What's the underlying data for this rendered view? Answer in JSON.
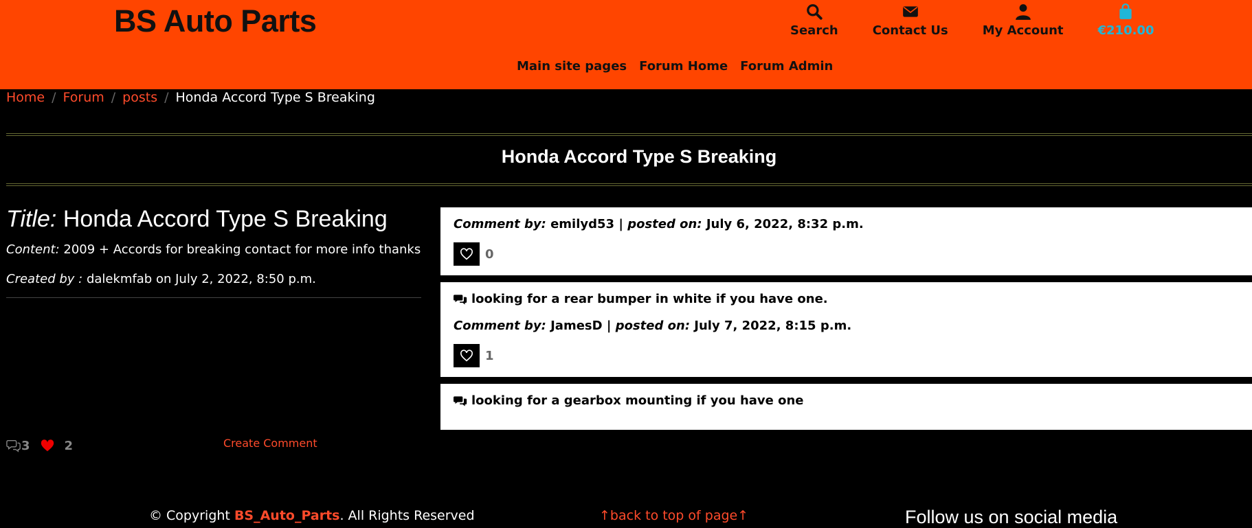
{
  "header": {
    "brand": "BS Auto Parts",
    "nav": {
      "search": "Search",
      "contact": "Contact Us",
      "account": "My Account",
      "cart_total": "€210.00"
    },
    "sub_nav": [
      "Main site pages",
      "Forum Home",
      "Forum Admin"
    ]
  },
  "breadcrumb": {
    "home": "Home",
    "forum": "Forum",
    "posts": "posts",
    "current": "Honda Accord Type S Breaking",
    "separator": "/"
  },
  "page_title": "Honda Accord Type S Breaking",
  "post": {
    "title_label": "Title:",
    "title": "Honda Accord Type S Breaking",
    "content_label": "Content:",
    "content": "2009 + Accords for breaking contact for more info thanks",
    "created_label": "Created by :",
    "created_value": "dalekmfab on July 2, 2022, 8:50 p.m.",
    "comment_count": "3",
    "like_count": "2",
    "create_comment": "Create Comment"
  },
  "comments": [
    {
      "text": "",
      "by_label": "Comment by:",
      "author": "emilyd53",
      "sep": "|",
      "posted_label": "posted on:",
      "posted": "July 6, 2022, 8:32 p.m.",
      "likes": "0"
    },
    {
      "text": "looking for a rear bumper in white if you have one.",
      "by_label": "Comment by:",
      "author": "JamesD",
      "sep": "|",
      "posted_label": "posted on:",
      "posted": "July 7, 2022, 8:15 p.m.",
      "likes": "1"
    },
    {
      "text": "looking for a gearbox mounting if you have one"
    }
  ],
  "footer": {
    "copyright_prefix": "© Copyright",
    "copyright_brand": "BS_Auto_Parts",
    "copyright_suffix": ". All Rights Reserved",
    "back_to_top": "back to top of page",
    "follow": "Follow us on social media"
  },
  "colors": {
    "header_bg": "#ff4500",
    "accent_link": "#ff4b2b",
    "cart": "#1fb6d8"
  }
}
